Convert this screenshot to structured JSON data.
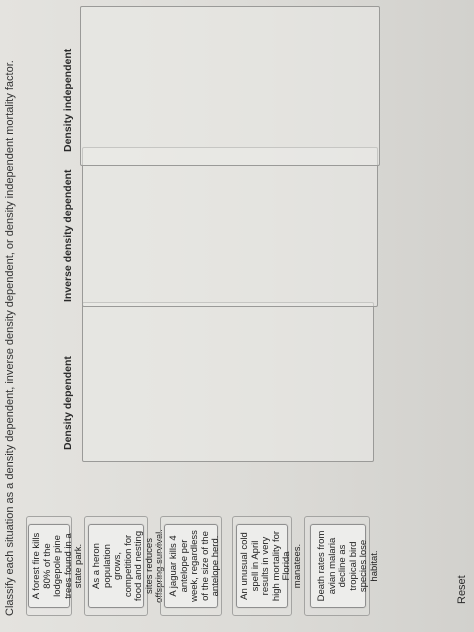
{
  "instruction": "Classify each situation as a density dependent, inverse density dependent, or density independent mortality factor.",
  "cards": [
    {
      "text": "A forest fire kills 80% of the lodgepole pine trees found in a state park."
    },
    {
      "text": "As a heron population grows, competition for food and nesting sites reduces offspring survival."
    },
    {
      "text": "A jaguar kills 4 antelope per week, regardless of the size of the antelope herd."
    },
    {
      "text": "An unusual cold spell in April results in very high mortality for Florida manatees."
    },
    {
      "text": "Death rates from avian malaria decline as tropical bird species lose habitat."
    }
  ],
  "columns": [
    {
      "title": "Density dependent"
    },
    {
      "title": "Inverse density dependent"
    },
    {
      "title": "Density independent"
    }
  ],
  "reset_label": "Reset"
}
